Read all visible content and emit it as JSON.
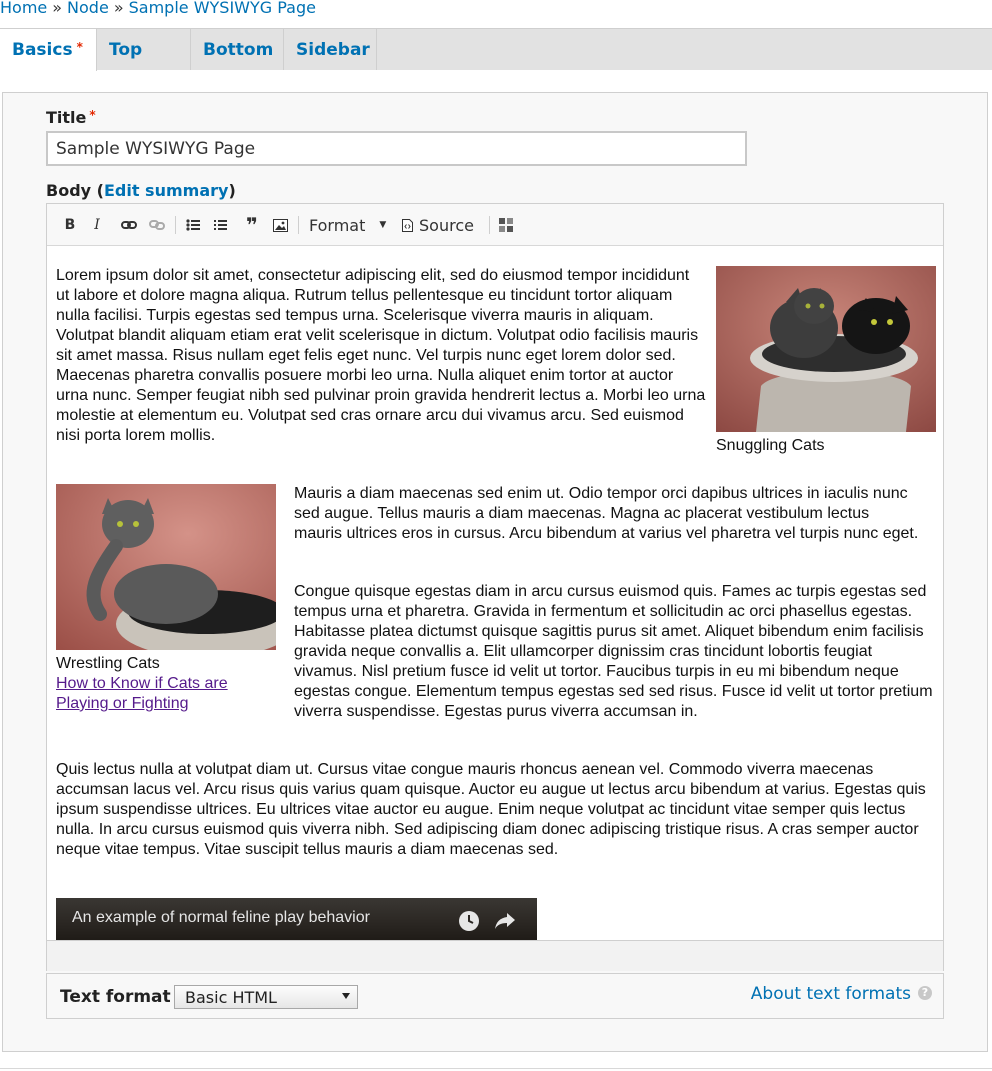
{
  "breadcrumb": {
    "items": [
      "Home",
      "Node",
      "Sample WYSIWYG Page"
    ],
    "separator": "»"
  },
  "tabs": [
    {
      "label": "Basics",
      "required": "*"
    },
    {
      "label": "Top"
    },
    {
      "label": "Bottom"
    },
    {
      "label": "Sidebar"
    }
  ],
  "title_field": {
    "label": "Title",
    "required": "*",
    "value": "Sample WYSIWYG Page"
  },
  "body_field": {
    "label": "Body",
    "paren_open": "(",
    "edit_summary": "Edit summary",
    "paren_close": ")"
  },
  "toolbar": {
    "bold": "B",
    "italic": "I",
    "blockquote": "❞",
    "format_label": "Format",
    "source_label": "Source"
  },
  "content": {
    "p1": "Lorem ipsum dolor sit amet, consectetur adipiscing elit, sed do eiusmod tempor incididunt ut labore et dolore magna aliqua. Rutrum tellus pellentesque eu tincidunt tortor aliquam nulla facilisi. Turpis egestas sed tempus urna. Scelerisque viverra mauris in aliquam. Volutpat blandit aliquam etiam erat velit scelerisque in dictum. Volutpat odio facilisis mauris sit amet massa. Risus nullam eget felis eget nunc. Vel turpis nunc eget lorem dolor sed. Maecenas pharetra convallis posuere morbi leo urna. Nulla aliquet enim tortor at auctor urna nunc. Semper feugiat nibh sed pulvinar proin gravida hendrerit lectus a. Morbi leo urna molestie at elementum eu. Volutpat sed cras ornare arcu dui vivamus arcu. Sed euismod nisi porta lorem mollis.",
    "image1_caption": "Snuggling Cats",
    "p2": "Mauris a diam maecenas sed enim ut. Odio tempor orci dapibus ultrices in iaculis nunc sed augue. Tellus mauris a diam maecenas. Magna ac placerat vestibulum lectus mauris ultrices eros in cursus. Arcu bibendum at varius vel pharetra vel turpis nunc eget.",
    "image2_caption": "Wrestling Cats",
    "image2_link": "How to Know if Cats are Playing or Fighting",
    "p3": "Congue quisque egestas diam in arcu cursus euismod quis. Fames ac turpis egestas sed tempus urna et pharetra. Gravida in fermentum et sollicitudin ac orci phasellus egestas. Habitasse platea dictumst quisque sagittis purus sit amet. Aliquet bibendum enim facilisis gravida neque convallis a. Elit ullamcorper dignissim cras tincidunt lobortis feugiat vivamus. Nisl pretium fusce id velit ut tortor. Faucibus turpis in eu mi bibendum neque egestas congue. Elementum tempus egestas sed sed risus. Fusce id velit ut tortor pretium viverra suspendisse. Egestas purus viverra accumsan in.",
    "p4": "Quis lectus nulla at volutpat diam ut. Cursus vitae congue mauris rhoncus aenean vel. Commodo viverra maecenas accumsan lacus vel. Arcu risus quis varius quam quisque. Auctor eu augue ut lectus arcu bibendum at varius. Egestas quis ipsum suspendisse ultrices. Eu ultrices vitae auctor eu augue. Enim neque volutpat ac tincidunt vitae semper quis lectus nulla. In arcu cursus euismod quis viverra nibh. Sed adipiscing diam donec adipiscing tristique risus. A cras semper auctor neque vitae tempus. Vitae suscipit tellus mauris a diam maecenas sed.",
    "video_title": "An example of normal feline play behavior"
  },
  "text_format": {
    "label": "Text format",
    "selected": "Basic HTML",
    "about_link": "About text formats",
    "help": "?"
  },
  "colors": {
    "link": "#0071b3",
    "required": "#e32700",
    "visited_link": "#551a8b"
  }
}
